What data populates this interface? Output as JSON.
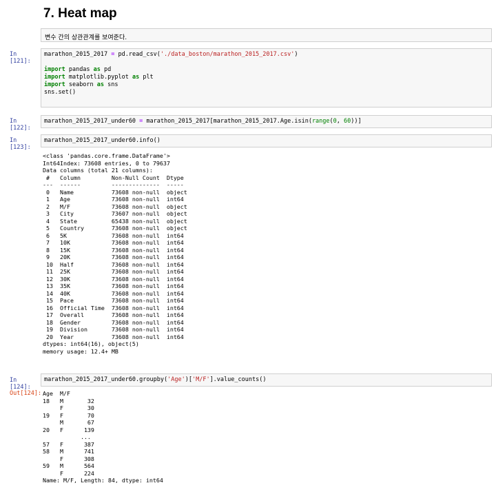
{
  "heading": "7. Heat map",
  "markdown_note": "변수 간의 상관관계를 보여준다.",
  "cells": [
    {
      "prompt": "In [121]:",
      "lines": [
        [
          {
            "t": "marathon_2015_2017 "
          },
          {
            "t": "=",
            "c": "op"
          },
          {
            "t": " pd.read_csv("
          },
          {
            "t": "'./data_boston/marathon_2015_2017.csv'",
            "c": "str"
          },
          {
            "t": ")"
          }
        ],
        [
          {
            "t": ""
          }
        ],
        [
          {
            "t": "import",
            "c": "kw"
          },
          {
            "t": " pandas "
          },
          {
            "t": "as",
            "c": "kw"
          },
          {
            "t": " pd"
          }
        ],
        [
          {
            "t": "import",
            "c": "kw"
          },
          {
            "t": " matplotlib.pyplot "
          },
          {
            "t": "as",
            "c": "kw"
          },
          {
            "t": " plt"
          }
        ],
        [
          {
            "t": "import",
            "c": "kw"
          },
          {
            "t": " seaborn "
          },
          {
            "t": "as",
            "c": "kw"
          },
          {
            "t": " sns"
          }
        ],
        [
          {
            "t": "sns.set()"
          }
        ]
      ]
    },
    {
      "prompt": "In [122]:",
      "lines": [
        [
          {
            "t": "marathon_2015_2017_under60 "
          },
          {
            "t": "=",
            "c": "op"
          },
          {
            "t": " marathon_2015_2017[marathon_2015_2017.Age.isin("
          },
          {
            "t": "range",
            "c": "num"
          },
          {
            "t": "("
          },
          {
            "t": "0",
            "c": "num"
          },
          {
            "t": ", "
          },
          {
            "t": "60",
            "c": "num"
          },
          {
            "t": "))]"
          }
        ]
      ]
    },
    {
      "prompt": "In [123]:",
      "lines": [
        [
          {
            "t": "marathon_2015_2017_under60.info()"
          }
        ]
      ]
    },
    {
      "prompt": "In [124]:",
      "lines": [
        [
          {
            "t": "marathon_2015_2017_under60.groupby("
          },
          {
            "t": "'Age'",
            "c": "str"
          },
          {
            "t": ")["
          },
          {
            "t": "'M/F'",
            "c": "str"
          },
          {
            "t": "].value_counts()"
          }
        ]
      ]
    }
  ],
  "info_output": "<class 'pandas.core.frame.DataFrame'>\nInt64Index: 73608 entries, 0 to 79637\nData columns (total 21 columns):\n #   Column         Non-Null Count  Dtype \n---  ------         --------------  ----- \n 0   Name           73608 non-null  object\n 1   Age            73608 non-null  int64 \n 2   M/F            73608 non-null  object\n 3   City           73607 non-null  object\n 4   State          65438 non-null  object\n 5   Country        73608 non-null  object\n 6   5K             73608 non-null  int64 \n 7   10K            73608 non-null  int64 \n 8   15K            73608 non-null  int64 \n 9   20K            73608 non-null  int64 \n 10  Half           73608 non-null  int64 \n 11  25K            73608 non-null  int64 \n 12  30K            73608 non-null  int64 \n 13  35K            73608 non-null  int64 \n 14  40K            73608 non-null  int64 \n 15  Pace           73608 non-null  int64 \n 16  Official Time  73608 non-null  int64 \n 17  Overall        73608 non-null  int64 \n 18  Gender         73608 non-null  int64 \n 19  Division       73608 non-null  int64 \n 20  Year           73608 non-null  int64 \ndtypes: int64(16), object(5)\nmemory usage: 12.4+ MB",
  "out_prompt": "Out[124]:",
  "value_counts_output": "Age  M/F\n18   M       32\n     F       30\n19   F       70\n     M       67\n20   F      139\n           ... \n57   F      387\n58   M      741\n     F      308\n59   M      564\n     F      224\nName: M/F, Length: 84, dtype: int64"
}
